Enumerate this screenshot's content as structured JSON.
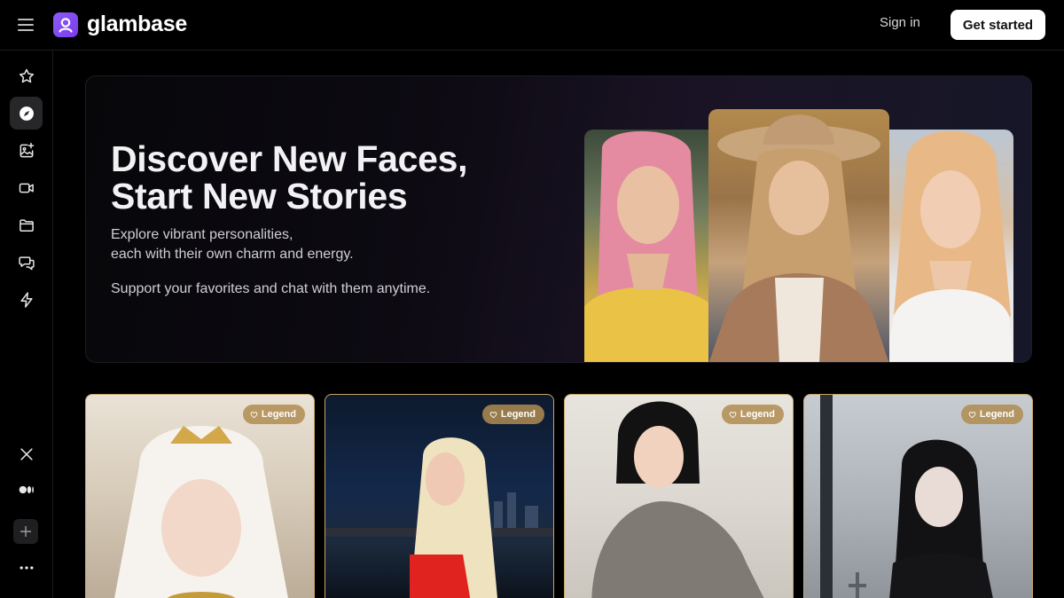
{
  "app": {
    "name": "glambase",
    "brand_color": "#8b5cf6"
  },
  "header": {
    "menu_icon": "hamburger-menu-icon",
    "signin_label": "Sign in",
    "get_started_label": "Get started"
  },
  "sidebar": {
    "items": [
      {
        "name": "favorites",
        "icon": "star-icon",
        "active": false
      },
      {
        "name": "explore",
        "icon": "compass-icon",
        "active": true
      },
      {
        "name": "generate-image",
        "icon": "image-sparkle-icon",
        "active": false
      },
      {
        "name": "video",
        "icon": "video-camera-icon",
        "active": false
      },
      {
        "name": "collections",
        "icon": "folder-icon",
        "active": false
      },
      {
        "name": "chats",
        "icon": "chat-bubbles-icon",
        "active": false
      },
      {
        "name": "boost",
        "icon": "lightning-icon",
        "active": false
      }
    ],
    "bottom": [
      {
        "name": "x-social",
        "icon": "x-logo-icon"
      },
      {
        "name": "medium-social",
        "icon": "medium-logo-icon"
      },
      {
        "name": "add",
        "icon": "plus-icon"
      },
      {
        "name": "more",
        "icon": "more-dots-icon"
      }
    ]
  },
  "hero": {
    "title_line1": "Discover New Faces,",
    "title_line2": "Start New Stories",
    "subtitle_line1": "Explore vibrant personalities,",
    "subtitle_line2": "each with their own charm and energy.",
    "subtitle_line3": "Support your favorites and chat with them anytime."
  },
  "cards": [
    {
      "badge": "Legend"
    },
    {
      "badge": "Legend"
    },
    {
      "badge": "Legend"
    },
    {
      "badge": "Legend"
    }
  ]
}
